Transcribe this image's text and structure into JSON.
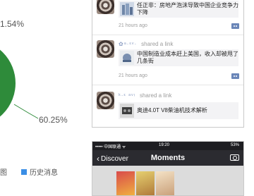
{
  "chart": {
    "label_top": "1.54%",
    "label_right": "60.25%",
    "legend": [
      {
        "label": "图",
        "color": "#2e8b3a"
      },
      {
        "label": "历史消息",
        "color": "#3a8ee6"
      }
    ],
    "colors": {
      "donut": "#2e8b3a",
      "leader_line": "#2e8b3a"
    }
  },
  "chart_data": {
    "type": "pie",
    "slices": [
      {
        "label": "1.54%",
        "value": 1.54
      },
      {
        "label": "60.25%",
        "value": 60.25
      }
    ],
    "legend": [
      "图",
      "历史消息"
    ]
  },
  "feed": {
    "posts": [
      {
        "author_blurred": "",
        "shared_text": "",
        "title": "任正非：房地产泡沫导致中国企业竞争力下降",
        "time": "21 hours ago"
      },
      {
        "author_blurred": "✿ᵃ·ᵋᵛ·",
        "shared_text": "shared a link",
        "title": "中国制造业成本赶上美国，收入却被甩了几条街",
        "time": "21 hours ago"
      },
      {
        "author_blurred": "ᵏ·ᵋ ᵃᵛᵎ",
        "shared_text": "shared a link",
        "title": "奥迪4.0T V8柴油机技术解析",
        "time": ""
      }
    ]
  },
  "phone": {
    "carrier": "••••• 中国联通 ᯤ",
    "clock": "19:20",
    "battery": "53%",
    "back_label": "Discover",
    "title": "Moments",
    "icons": {
      "back": "chevron-left-icon",
      "camera": "camera-icon"
    }
  }
}
